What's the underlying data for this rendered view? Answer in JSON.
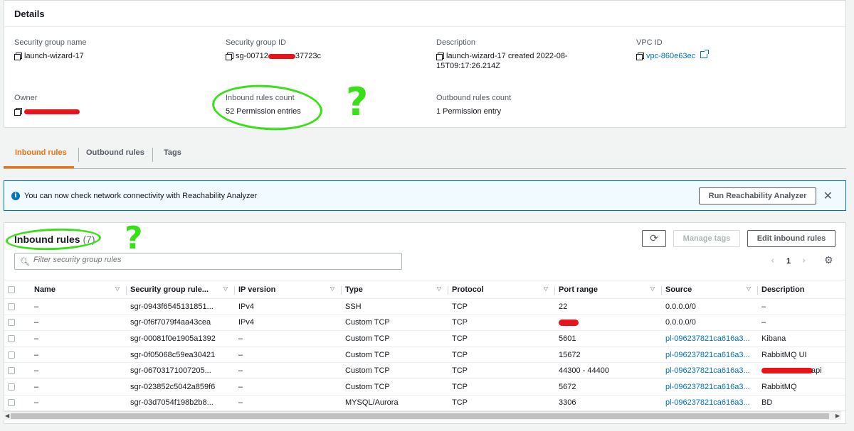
{
  "details": {
    "title": "Details",
    "fields": {
      "sg_name": {
        "label": "Security group name",
        "value": "launch-wizard-17"
      },
      "sg_id": {
        "label": "Security group ID",
        "value_prefix": "sg-00712",
        "value_suffix": "37723c"
      },
      "description": {
        "label": "Description",
        "line1": "launch-wizard-17 created 2022-08-",
        "line2": "15T09:17:26.214Z"
      },
      "vpc_id": {
        "label": "VPC ID",
        "value": "vpc-860e63ec"
      },
      "owner": {
        "label": "Owner"
      },
      "inbound_count": {
        "label": "Inbound rules count",
        "value": "52 Permission entries"
      },
      "outbound_count": {
        "label": "Outbound rules count",
        "value": "1 Permission entry"
      }
    }
  },
  "annotations": {
    "q1": "?",
    "q2": "?"
  },
  "tabs": [
    {
      "label": "Inbound rules",
      "active": true
    },
    {
      "label": "Outbound rules",
      "active": false
    },
    {
      "label": "Tags",
      "active": false
    }
  ],
  "banner": {
    "text": "You can now check network connectivity with Reachability Analyzer",
    "button": "Run Reachability Analyzer"
  },
  "rules": {
    "title": "Inbound rules",
    "count": "(7)",
    "buttons": {
      "manage_tags": "Manage tags",
      "edit": "Edit inbound rules"
    },
    "filter_placeholder": "Filter security group rules",
    "page": "1",
    "columns": [
      "Name",
      "Security group rule...",
      "IP version",
      "Type",
      "Protocol",
      "Port range",
      "Source",
      "Description"
    ],
    "rows": [
      {
        "name": "–",
        "rule_id": "sgr-0943f6545131851...",
        "ip": "IPv4",
        "type": "SSH",
        "protocol": "TCP",
        "port": "22",
        "source": "0.0.0.0/0",
        "source_link": false,
        "desc": "–"
      },
      {
        "name": "–",
        "rule_id": "sgr-0f6f7079f4aa43cea",
        "ip": "IPv4",
        "type": "Custom TCP",
        "protocol": "TCP",
        "port": "",
        "port_redacted": true,
        "source": "0.0.0.0/0",
        "source_link": false,
        "desc": "–"
      },
      {
        "name": "–",
        "rule_id": "sgr-00081f0e1905a1392",
        "ip": "–",
        "type": "Custom TCP",
        "protocol": "TCP",
        "port": "5601",
        "source": "pl-096237821ca616a3...",
        "source_link": true,
        "desc": "Kibana"
      },
      {
        "name": "–",
        "rule_id": "sgr-0f05068c59ea30421",
        "ip": "–",
        "type": "Custom TCP",
        "protocol": "TCP",
        "port": "15672",
        "source": "pl-096237821ca616a3...",
        "source_link": true,
        "desc": "RabbitMQ UI"
      },
      {
        "name": "–",
        "rule_id": "sgr-06703171007205...",
        "ip": "–",
        "type": "Custom TCP",
        "protocol": "TCP",
        "port": "44300 - 44400",
        "source": "pl-096237821ca616a3...",
        "source_link": true,
        "desc": "api",
        "desc_redacted": true
      },
      {
        "name": "–",
        "rule_id": "sgr-023852c5042a859f6",
        "ip": "–",
        "type": "Custom TCP",
        "protocol": "TCP",
        "port": "5672",
        "source": "pl-096237821ca616a3...",
        "source_link": true,
        "desc": "RabbitMQ"
      },
      {
        "name": "–",
        "rule_id": "sgr-03d7054f198b2b8...",
        "ip": "–",
        "type": "MYSQL/Aurora",
        "protocol": "TCP",
        "port": "3306",
        "source": "pl-096237821ca616a3...",
        "source_link": true,
        "desc": "BD"
      }
    ]
  },
  "colors": {
    "accent": "#ec7211",
    "link": "#0073bb",
    "annotation": "#39e018",
    "redaction": "#e8141c"
  }
}
